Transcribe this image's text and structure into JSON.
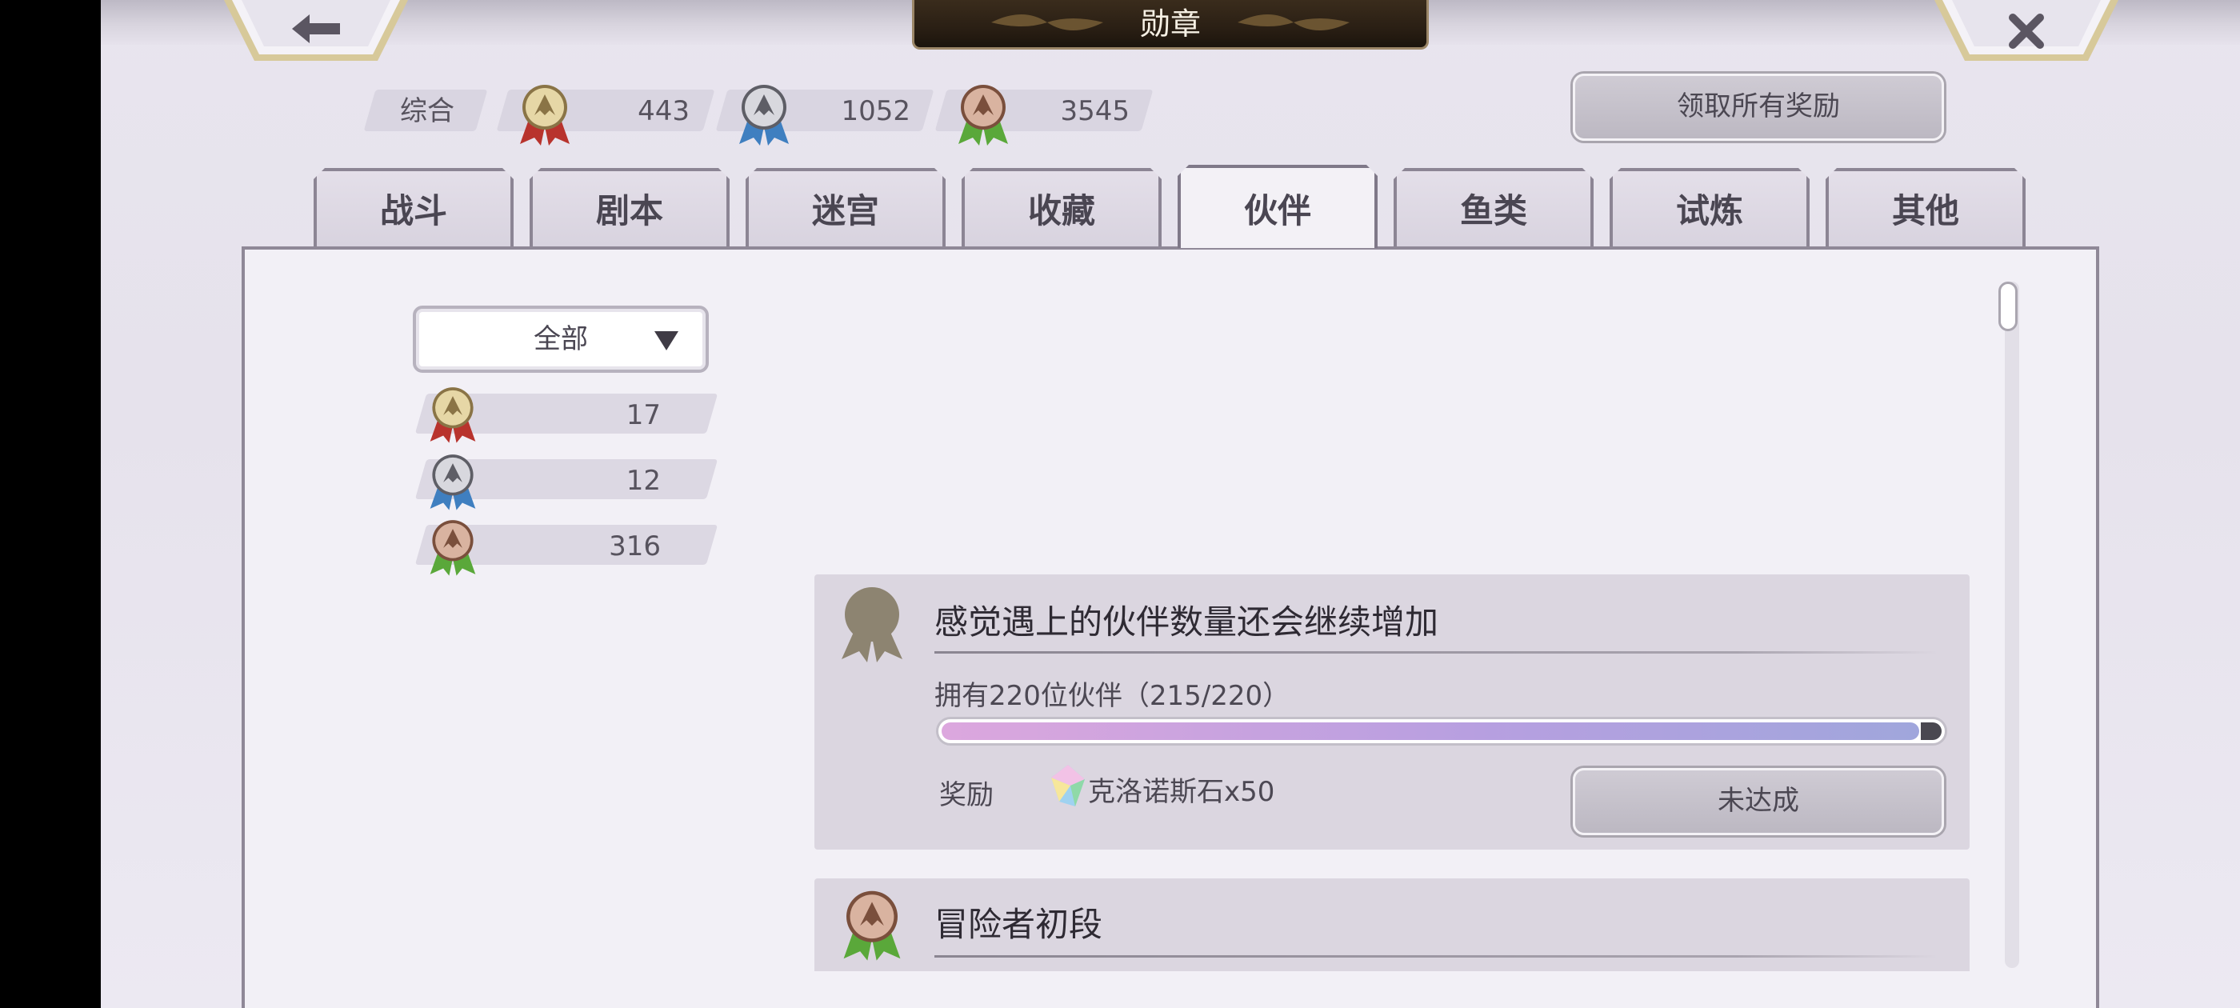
{
  "header": {
    "title": "勋章",
    "back_icon": "back-arrow-icon",
    "close_icon": "close-icon"
  },
  "summary": {
    "label": "综合",
    "gold": "443",
    "silver": "1052",
    "bronze": "3545"
  },
  "claim_all_label": "领取所有奖励",
  "tabs": [
    {
      "label": "战斗"
    },
    {
      "label": "剧本"
    },
    {
      "label": "迷宫"
    },
    {
      "label": "收藏"
    },
    {
      "label": "伙伴"
    },
    {
      "label": "鱼类"
    },
    {
      "label": "试炼"
    },
    {
      "label": "其他"
    }
  ],
  "active_tab": "伙伴",
  "filter": {
    "selected": "全部",
    "counts": {
      "gold": "17",
      "silver": "12",
      "bronze": "316"
    }
  },
  "cards": [
    {
      "title": "感觉遇上的伙伴数量还会继续增加",
      "condition": "拥有220位伙伴（215/220）",
      "progress": {
        "current": 215,
        "total": 220
      },
      "reward_label": "奖励",
      "reward": "克洛诺斯石x50",
      "status": "未达成",
      "medal": "locked"
    },
    {
      "title": "冒险者初段",
      "medal": "bronze"
    }
  ],
  "colors": {
    "gold_ribbon": "#b8332d",
    "silver_ribbon": "#3f7fc0",
    "bronze_ribbon": "#5aa83a",
    "progress_start": "#dca7de",
    "progress_end": "#a0a6dc"
  }
}
